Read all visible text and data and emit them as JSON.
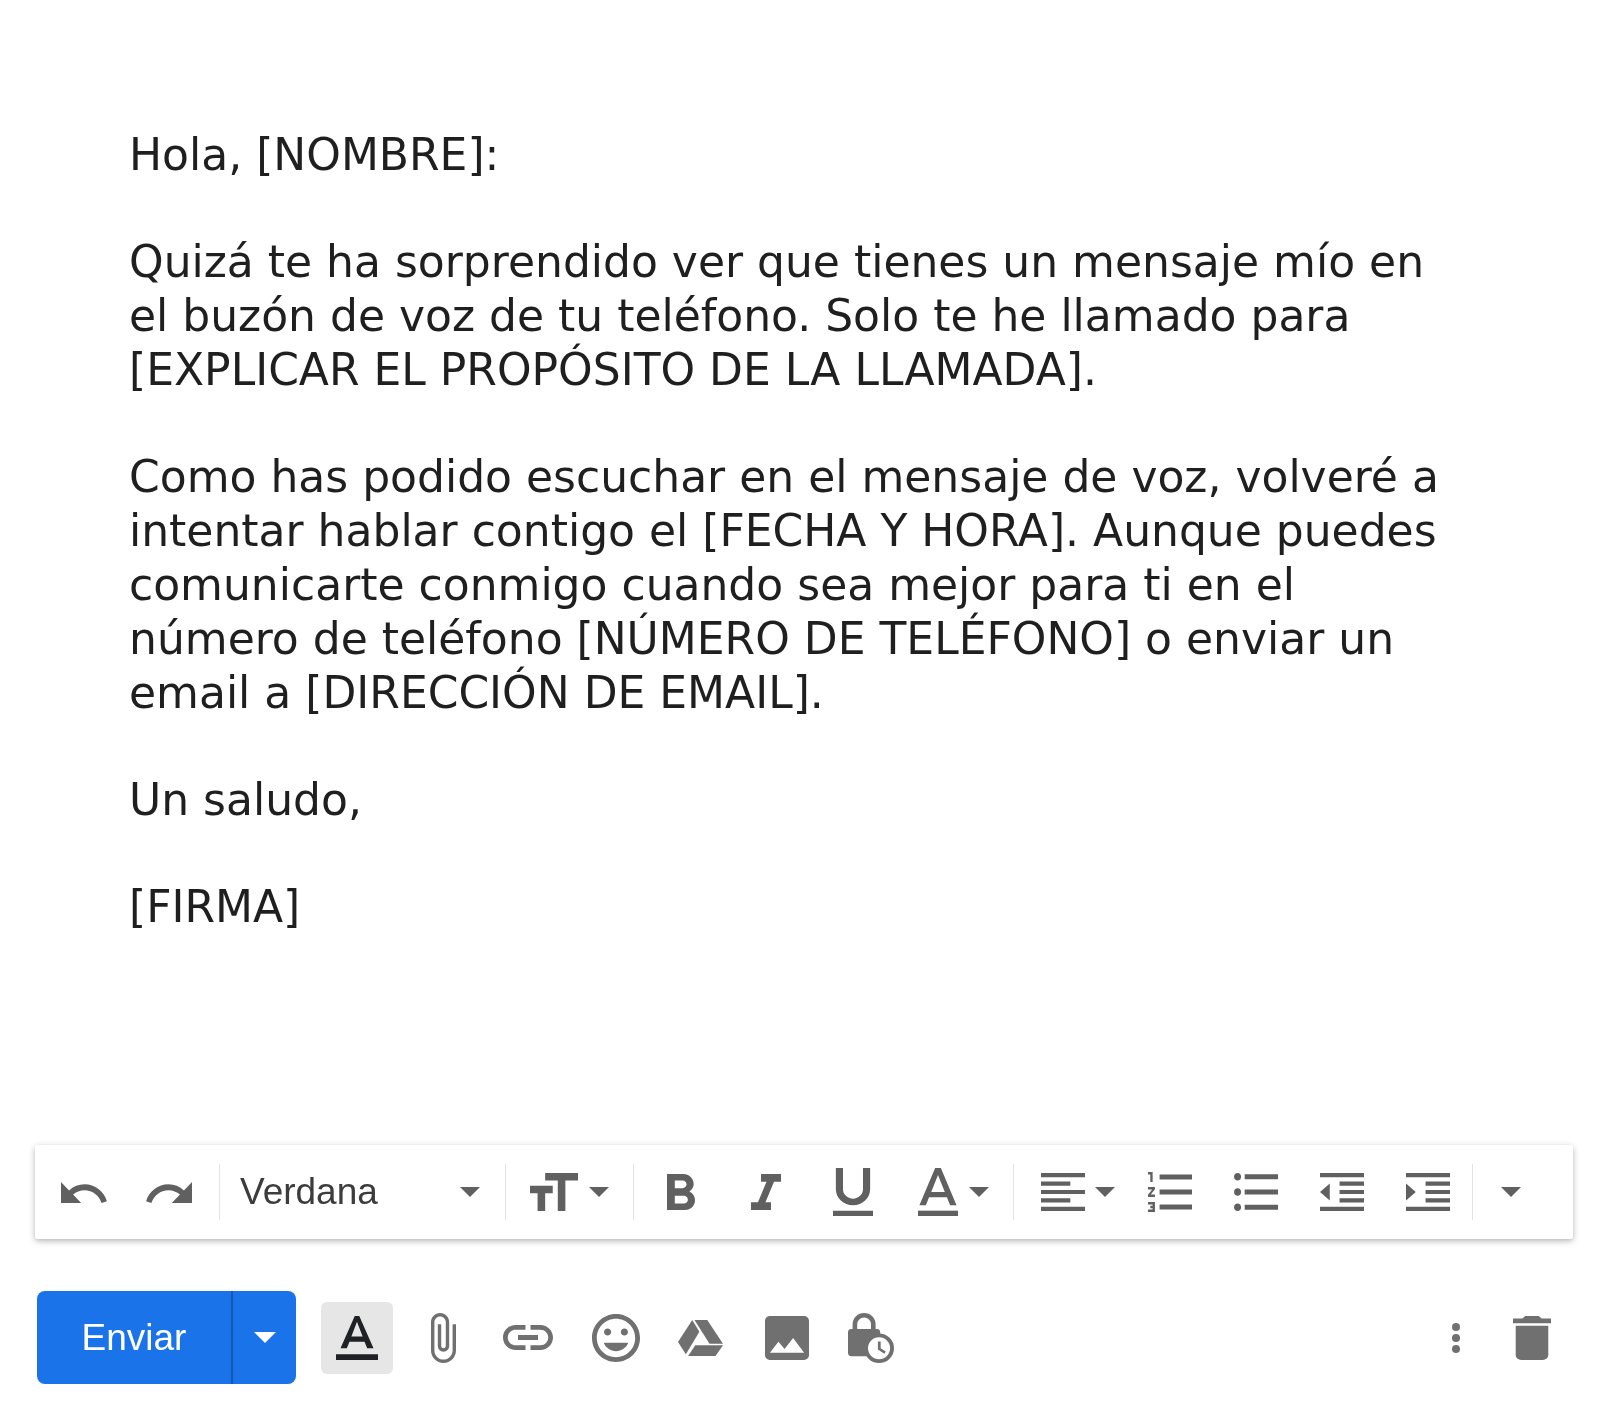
{
  "message": {
    "greeting": "Hola, [NOMBRE]:",
    "paragraphs": [
      "Quizá te ha sorprendido ver que tienes un mensaje mío en el buzón de voz de tu teléfono. Solo te he llamado para [EXPLICAR EL PROPÓSITO DE LA LLAMADA].",
      "Como has podido escuchar en el mensaje de voz, volveré a intentar hablar contigo el [FECHA Y HORA]. Aunque puedes comunicarte conmigo cuando sea mejor para ti en el número de teléfono [NÚMERO DE TELÉFONO] o enviar un email a [DIRECCIÓN DE EMAIL]."
    ],
    "closing": "Un saludo,",
    "signature": "[FIRMA]"
  },
  "formatting_toolbar": {
    "font": "Verdana"
  },
  "send_button": {
    "label": "Enviar"
  },
  "formatting_options_button": {
    "selected": true
  }
}
